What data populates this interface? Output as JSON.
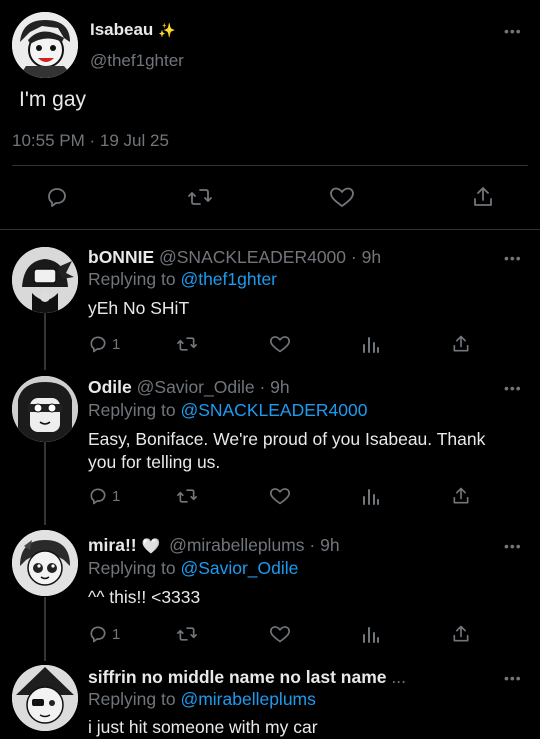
{
  "main_tweet": {
    "display_name": "Isabeau",
    "name_emoji": "✨",
    "handle": "@thef1ghter",
    "text": "I'm gay",
    "time": "10:55 PM",
    "separator": "·",
    "date": "19 Jul 25",
    "more": "•••"
  },
  "replies": [
    {
      "display_name": "bONNIE",
      "handle": "@SNACKLEADER4000",
      "age": "· 9h",
      "replying_label": "Replying to",
      "replying_to": "@thef1ghter",
      "text": "yEh No SHiT",
      "reply_count": "1",
      "more": "•••"
    },
    {
      "display_name": "Odile",
      "handle": "@Savior_Odile",
      "age": "· 9h",
      "replying_label": "Replying to",
      "replying_to": "@SNACKLEADER4000",
      "text_line1": "Easy, Boniface. We're proud of you Isabeau. Thank",
      "text_line2": "you for telling us.",
      "reply_count": "1",
      "more": "•••"
    },
    {
      "display_name": "mira!!",
      "name_emoji": "🤍",
      "handle": "@mirabelleplums",
      "age": "· 9h",
      "replying_label": "Replying to",
      "replying_to": "@Savior_Odile",
      "text": "^^ this!! <3333",
      "reply_count": "1",
      "more": "•••"
    },
    {
      "display_name": "siffrin no middle name no last name",
      "ellipsis": "...",
      "replying_label": "Replying to",
      "replying_to": "@mirabelleplums",
      "text": "i just hit someone with my car",
      "more": "•••"
    }
  ],
  "icons": {
    "reply": "reply-icon",
    "retweet": "retweet-icon",
    "like": "like-icon",
    "views": "views-icon",
    "share": "share-icon"
  },
  "colors": {
    "background": "#000000",
    "text": "#e7e9ea",
    "secondary": "#71767b",
    "accent": "#1d9bf0"
  }
}
